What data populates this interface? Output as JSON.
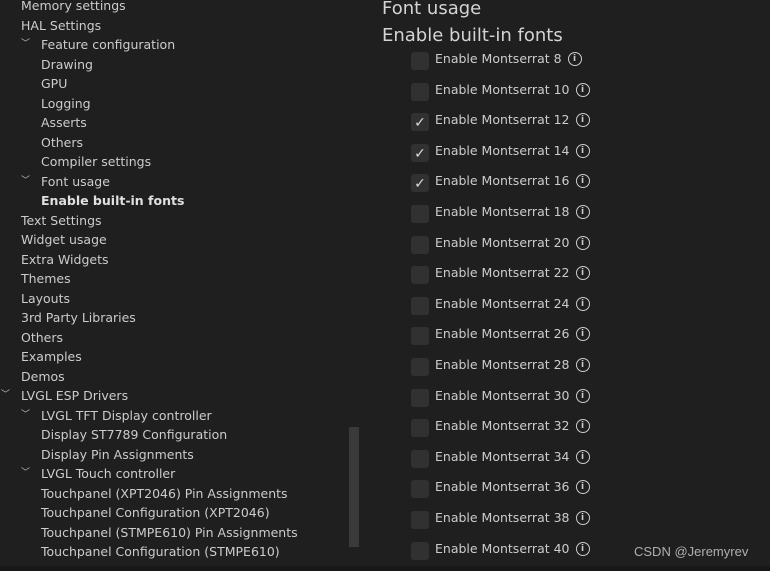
{
  "tree": [
    {
      "label": "Memory settings",
      "level": 0,
      "chevron": false,
      "bold": false
    },
    {
      "label": "HAL Settings",
      "level": 0,
      "chevron": false,
      "bold": false
    },
    {
      "label": "Feature configuration",
      "level": 1,
      "chevron": true,
      "bold": false
    },
    {
      "label": "Drawing",
      "level": 1,
      "chevron": false,
      "bold": false
    },
    {
      "label": "GPU",
      "level": 1,
      "chevron": false,
      "bold": false
    },
    {
      "label": "Logging",
      "level": 1,
      "chevron": false,
      "bold": false
    },
    {
      "label": "Asserts",
      "level": 1,
      "chevron": false,
      "bold": false
    },
    {
      "label": "Others",
      "level": 1,
      "chevron": false,
      "bold": false
    },
    {
      "label": "Compiler settings",
      "level": 1,
      "chevron": false,
      "bold": false
    },
    {
      "label": "Font usage",
      "level": 1,
      "chevron": true,
      "bold": false
    },
    {
      "label": "Enable built-in fonts",
      "level": 1,
      "chevron": false,
      "bold": true
    },
    {
      "label": "Text Settings",
      "level": 0,
      "chevron": false,
      "bold": false
    },
    {
      "label": "Widget usage",
      "level": 0,
      "chevron": false,
      "bold": false
    },
    {
      "label": "Extra Widgets",
      "level": 0,
      "chevron": false,
      "bold": false
    },
    {
      "label": "Themes",
      "level": 0,
      "chevron": false,
      "bold": false
    },
    {
      "label": "Layouts",
      "level": 0,
      "chevron": false,
      "bold": false
    },
    {
      "label": "3rd Party Libraries",
      "level": 0,
      "chevron": false,
      "bold": false
    },
    {
      "label": "Others",
      "level": 0,
      "chevron": false,
      "bold": false
    },
    {
      "label": "Examples",
      "level": 0,
      "chevron": false,
      "bold": false
    },
    {
      "label": "Demos",
      "level": 0,
      "chevron": false,
      "bold": false
    },
    {
      "label": "LVGL ESP Drivers",
      "level": 0,
      "chevron": true,
      "bold": false
    },
    {
      "label": "LVGL TFT Display controller",
      "level": 1,
      "chevron": true,
      "bold": false
    },
    {
      "label": "Display ST7789 Configuration",
      "level": 1,
      "chevron": false,
      "bold": false
    },
    {
      "label": "Display Pin Assignments",
      "level": 1,
      "chevron": false,
      "bold": false
    },
    {
      "label": "LVGL Touch controller",
      "level": 1,
      "chevron": true,
      "bold": false
    },
    {
      "label": "Touchpanel (XPT2046) Pin Assignments",
      "level": 1,
      "chevron": false,
      "bold": false
    },
    {
      "label": "Touchpanel Configuration (XPT2046)",
      "level": 1,
      "chevron": false,
      "bold": false
    },
    {
      "label": "Touchpanel (STMPE610) Pin Assignments",
      "level": 1,
      "chevron": false,
      "bold": false
    },
    {
      "label": "Touchpanel Configuration (STMPE610)",
      "level": 1,
      "chevron": false,
      "bold": false
    }
  ],
  "main": {
    "section_title": "Font usage",
    "subsection_title": "Enable built-in fonts",
    "options": [
      {
        "label": "Enable Montserrat 8",
        "checked": false
      },
      {
        "label": "Enable Montserrat 10",
        "checked": false
      },
      {
        "label": "Enable Montserrat 12",
        "checked": true
      },
      {
        "label": "Enable Montserrat 14",
        "checked": true
      },
      {
        "label": "Enable Montserrat 16",
        "checked": true
      },
      {
        "label": "Enable Montserrat 18",
        "checked": false
      },
      {
        "label": "Enable Montserrat 20",
        "checked": false
      },
      {
        "label": "Enable Montserrat 22",
        "checked": false
      },
      {
        "label": "Enable Montserrat 24",
        "checked": false
      },
      {
        "label": "Enable Montserrat 26",
        "checked": false
      },
      {
        "label": "Enable Montserrat 28",
        "checked": false
      },
      {
        "label": "Enable Montserrat 30",
        "checked": false
      },
      {
        "label": "Enable Montserrat 32",
        "checked": false
      },
      {
        "label": "Enable Montserrat 34",
        "checked": false
      },
      {
        "label": "Enable Montserrat 36",
        "checked": false
      },
      {
        "label": "Enable Montserrat 38",
        "checked": false
      },
      {
        "label": "Enable Montserrat 40",
        "checked": false
      }
    ],
    "check_glyph": "✓",
    "info_glyph": "i"
  },
  "watermark": "CSDN @Jeremyrev",
  "colors": {
    "background": "#1f1f1f",
    "text": "#cccccc",
    "checkbox": "#313131"
  }
}
